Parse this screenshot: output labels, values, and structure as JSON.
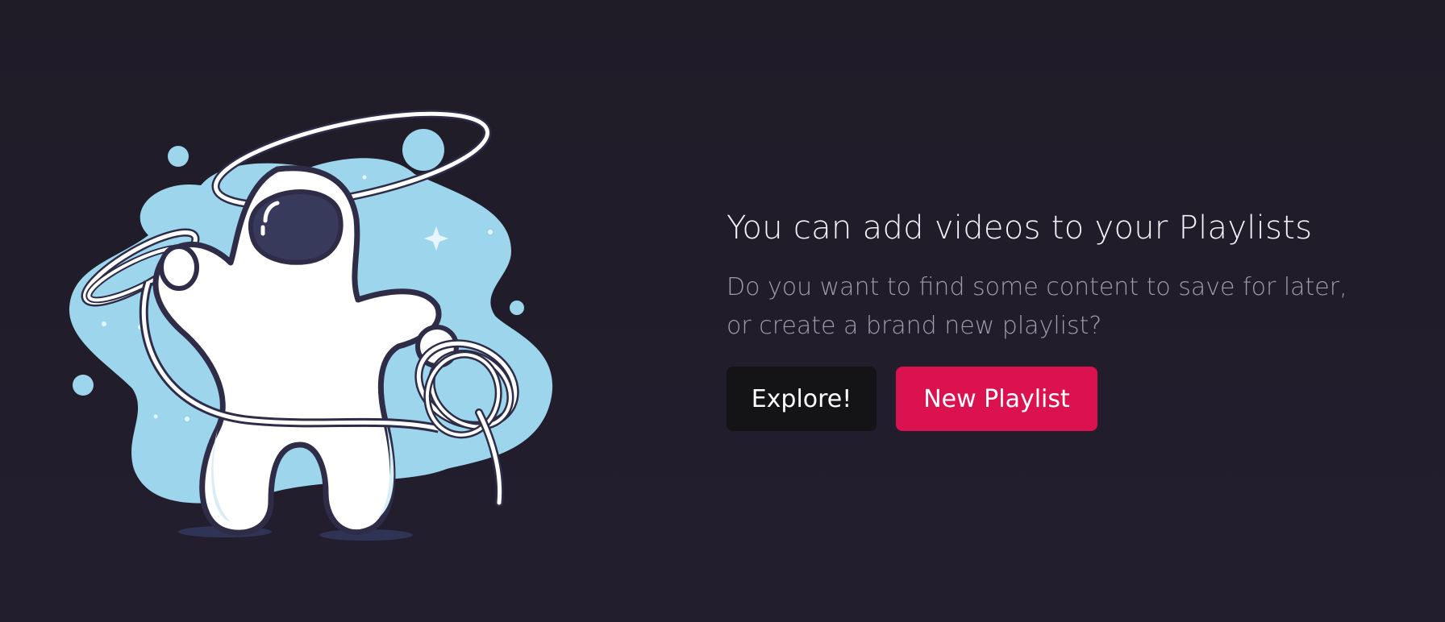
{
  "empty_state": {
    "illustration_name": "astronaut-lasso-illustration",
    "title": "You can add videos to your Playlists",
    "subtitle": "Do you want to find some content to save for later, or create a brand new playlist?"
  },
  "actions": {
    "explore_label": "Explore!",
    "new_playlist_label": "New Playlist"
  },
  "colors": {
    "background": "#211d2b",
    "accent": "#dc1250",
    "secondary_button": "#141316",
    "blob": "#9dd6ec",
    "outline": "#2f2c47"
  }
}
